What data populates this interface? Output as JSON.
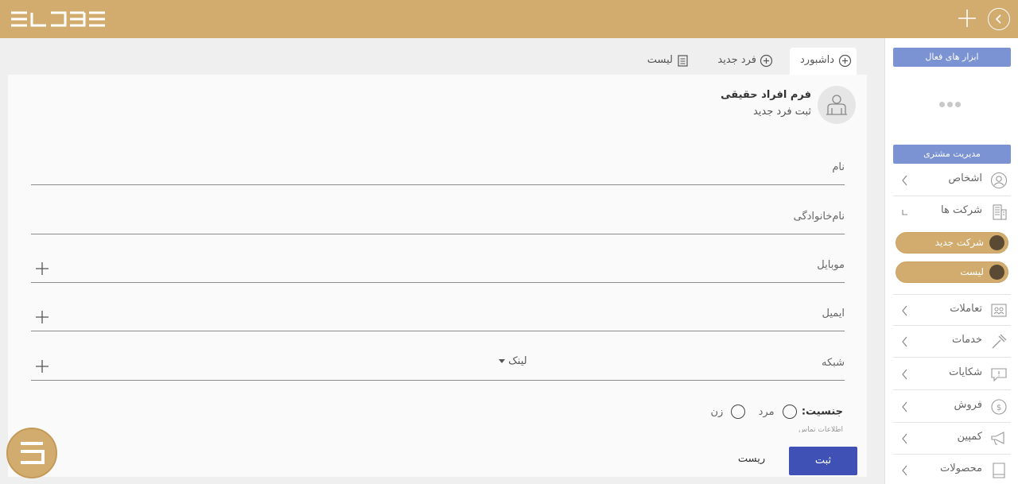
{
  "header": {
    "logo_icon": "brand-logo-icon",
    "add_icon": "plus-icon",
    "nav_icon": "chevron-circle-icon"
  },
  "tabs": [
    {
      "label": "داشبورد",
      "icon": "plus-circle-icon"
    },
    {
      "label": "فرد جدید",
      "icon": "plus-circle-icon"
    },
    {
      "label": "لیست",
      "icon": "document-icon"
    }
  ],
  "form": {
    "title": "فرم افراد حقیقی",
    "subtitle": "ثبت فرد جدید",
    "fields": {
      "first_name": "نام",
      "last_name": "نام‌خانوادگی",
      "mobile": "موبایل",
      "email": "ایمیل",
      "network": "شبکه",
      "network_select": "لینک"
    },
    "gender_label": "جنسیت:",
    "gender_options": [
      "مرد",
      "زن"
    ],
    "contact_note": "اطلاعات تماس",
    "submit_label": "ثبت",
    "reset_label": "ریست"
  },
  "sidebar": {
    "active_tools": "ابزار های فعال",
    "customer_management": "مدیریت مشتری",
    "items": [
      {
        "label": "اشخاص",
        "icon": "people-icon"
      },
      {
        "label": "شرکت ها",
        "icon": "building-icon"
      },
      {
        "label": "تعاملات",
        "icon": "interaction-icon"
      },
      {
        "label": "خدمات",
        "icon": "hammer-icon"
      },
      {
        "label": "شکایات",
        "icon": "complaint-icon"
      },
      {
        "label": "فروش",
        "icon": "dollar-icon"
      },
      {
        "label": "کمپین",
        "icon": "megaphone-icon"
      },
      {
        "label": "محصولات",
        "icon": "box-icon"
      }
    ],
    "sub_items": [
      {
        "label": "شرکت جدید",
        "icon": "plus-circle-icon"
      },
      {
        "label": "لیست",
        "icon": "document-icon"
      }
    ]
  },
  "colors": {
    "topbar": "#d2ac6e",
    "accent_blue": "#7b93d2",
    "submit_blue": "#3f51b5"
  }
}
